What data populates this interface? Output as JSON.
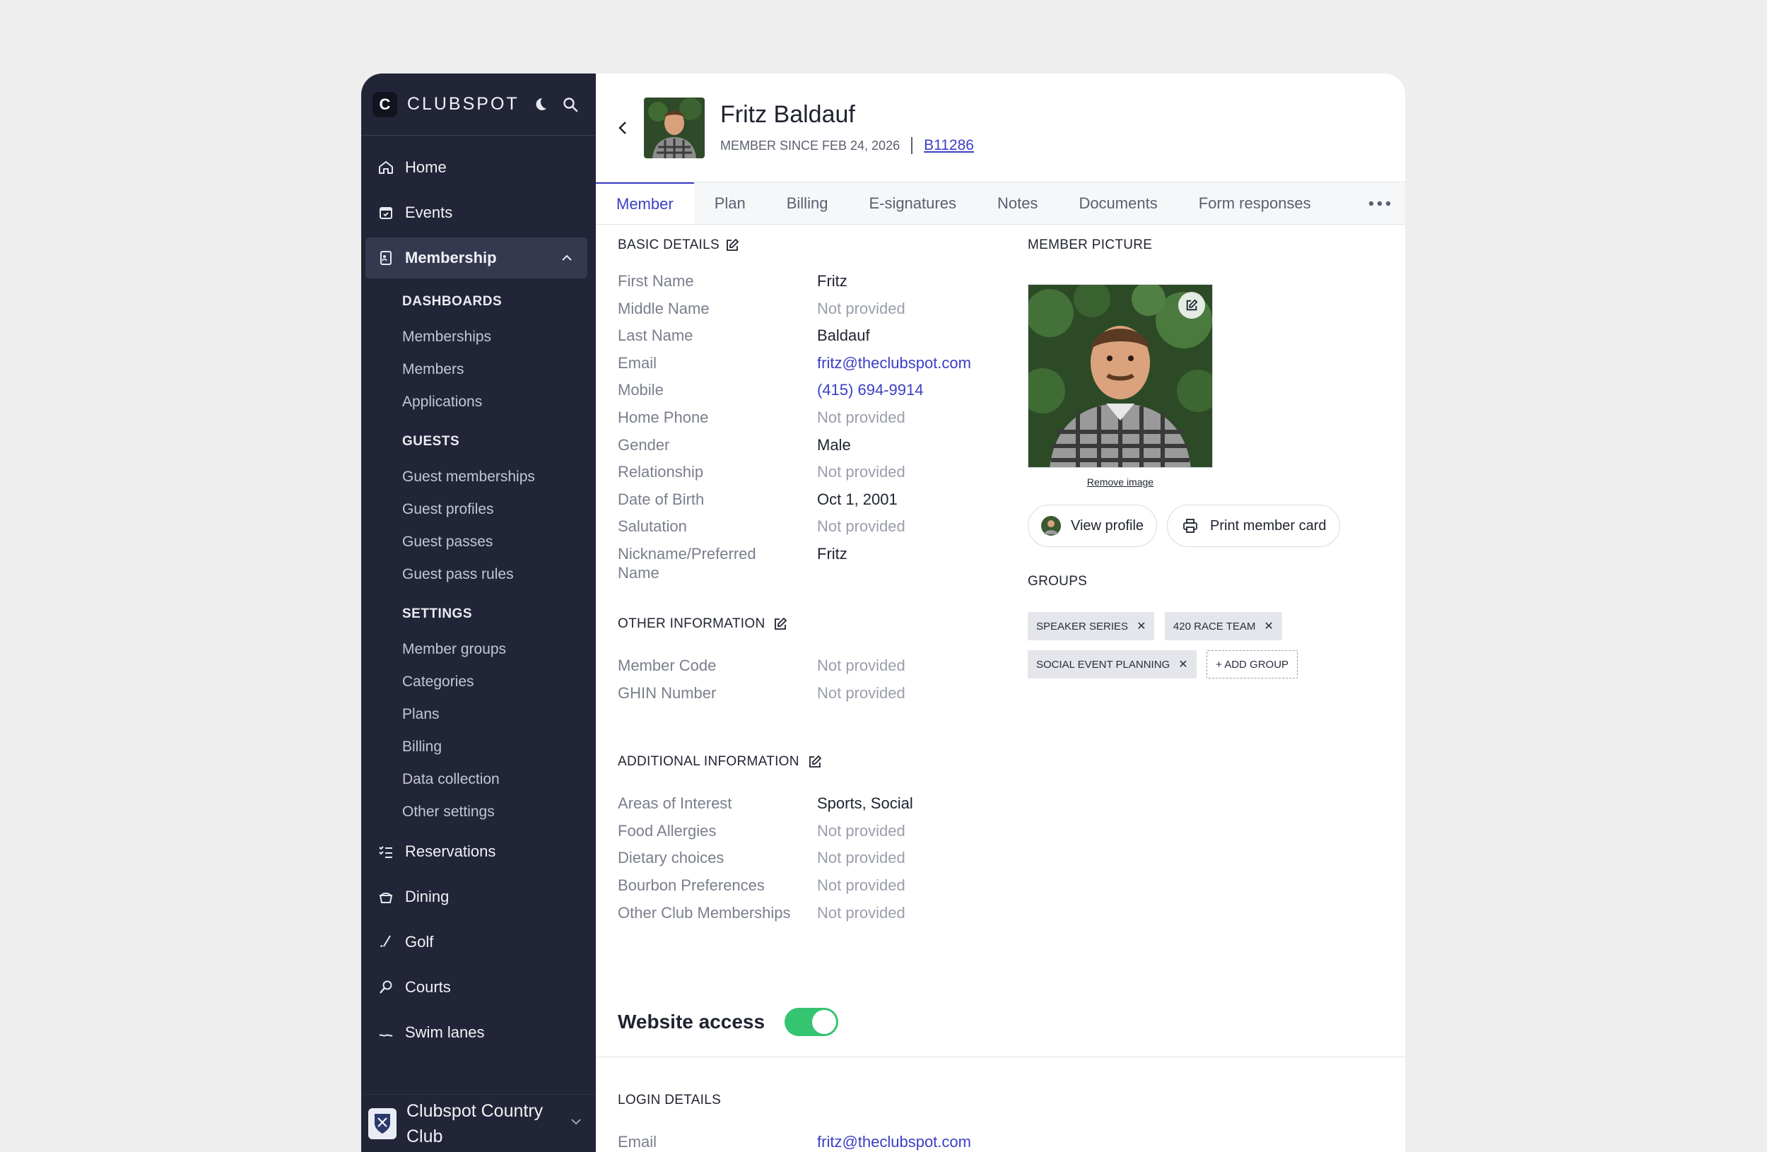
{
  "brand": {
    "name": "CLUBSPOT",
    "logo_letter": "C"
  },
  "nav": {
    "home": "Home",
    "events": "Events",
    "membership": "Membership",
    "dashboards_head": "DASHBOARDS",
    "dashboards": [
      "Memberships",
      "Members",
      "Applications"
    ],
    "guests_head": "GUESTS",
    "guests": [
      "Guest memberships",
      "Guest profiles",
      "Guest passes",
      "Guest pass rules"
    ],
    "settings_head": "SETTINGS",
    "settings": [
      "Member groups",
      "Categories",
      "Plans",
      "Billing",
      "Data collection",
      "Other settings"
    ],
    "reservations": "Reservations",
    "dining": "Dining",
    "golf": "Golf",
    "courts": "Courts",
    "swim": "Swim lanes"
  },
  "club": {
    "name": "Clubspot Country Club"
  },
  "member": {
    "name": "Fritz Baldauf",
    "since": "MEMBER SINCE FEB 24, 2026",
    "id": "B11286"
  },
  "tabs": [
    "Member",
    "Plan",
    "Billing",
    "E-signatures",
    "Notes",
    "Documents",
    "Form responses"
  ],
  "basic": {
    "title": "BASIC DETAILS",
    "rows": [
      {
        "label": "First Name",
        "value": "Fritz"
      },
      {
        "label": "Middle Name",
        "value": "Not provided"
      },
      {
        "label": "Last Name",
        "value": "Baldauf"
      },
      {
        "label": "Email",
        "value": "fritz@theclubspot.com"
      },
      {
        "label": "Mobile",
        "value": "(415) 694-9914"
      },
      {
        "label": "Home Phone",
        "value": "Not provided"
      },
      {
        "label": "Gender",
        "value": "Male"
      },
      {
        "label": "Relationship",
        "value": "Not provided"
      },
      {
        "label": "Date of Birth",
        "value": "Oct 1, 2001"
      },
      {
        "label": "Salutation",
        "value": "Not provided"
      },
      {
        "label": "Nickname/Preferred Name",
        "value": "Fritz"
      }
    ]
  },
  "other": {
    "title": "OTHER INFORMATION",
    "rows": [
      {
        "label": "Member Code",
        "value": "Not provided"
      },
      {
        "label": "GHIN Number",
        "value": "Not provided"
      }
    ]
  },
  "additional": {
    "title": "ADDITIONAL INFORMATION",
    "rows": [
      {
        "label": "Areas of Interest",
        "value": "Sports, Social"
      },
      {
        "label": "Food Allergies",
        "value": "Not provided"
      },
      {
        "label": "Dietary choices",
        "value": "Not provided"
      },
      {
        "label": "Bourbon Preferences",
        "value": "Not provided"
      },
      {
        "label": "Other Club Memberships",
        "value": "Not provided"
      }
    ]
  },
  "picture": {
    "title": "MEMBER PICTURE",
    "remove": "Remove image",
    "view_profile": "View profile",
    "print_card": "Print member card"
  },
  "groups": {
    "title": "GROUPS",
    "items": [
      "SPEAKER SERIES",
      "420 RACE TEAM",
      "SOCIAL EVENT PLANNING"
    ],
    "add": "+ ADD GROUP"
  },
  "website": {
    "title": "Website access",
    "enabled": true
  },
  "login": {
    "title": "LOGIN DETAILS",
    "email_label": "Email",
    "email_value": "fritz@theclubspot.com"
  },
  "colors": {
    "accent": "#3b3fc4",
    "sidebar": "#222537",
    "toggle_on": "#35c46f"
  }
}
